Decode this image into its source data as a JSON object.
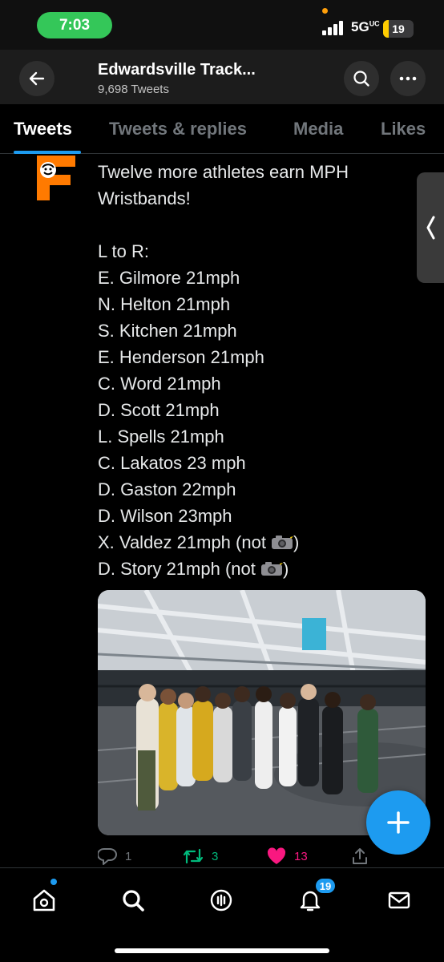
{
  "status_bar": {
    "time": "7:03",
    "network": "5GUC",
    "battery": "19"
  },
  "header": {
    "title": "Edwardsville Track...",
    "subtitle": "9,698 Tweets"
  },
  "tabs": [
    {
      "label": "Tweets",
      "active": true
    },
    {
      "label": "Tweets & replies",
      "active": false
    },
    {
      "label": "Media",
      "active": false
    },
    {
      "label": "Likes",
      "active": false
    }
  ],
  "tweet": {
    "lines": [
      "Twelve more athletes earn MPH",
      "Wristbands!",
      "",
      "L to R:",
      "E. Gilmore 21mph",
      "N. Helton 21mph",
      "S. Kitchen 21mph",
      "E. Henderson 21mph",
      "C. Word 21mph",
      "D. Scott 21mph",
      "L. Spells 21mph",
      "C. Lakatos 23 mph",
      "D. Gaston 22mph",
      "D. Wilson 23mph"
    ],
    "camera_lines": [
      {
        "before": "X. Valdez 21mph (not ",
        "after": ")"
      },
      {
        "before": "D. Story 21mph (not ",
        "after": ")"
      }
    ],
    "reply_count": "1",
    "retweet_count": "3",
    "like_count": "13"
  },
  "bottom_nav": {
    "notifications_badge": "19"
  },
  "colors": {
    "accent": "#1d9bf0",
    "retweet": "#00ba7c",
    "like": "#f91880",
    "status_pill": "#34c759"
  },
  "icons": [
    "back-arrow-icon",
    "search-icon",
    "more-icon",
    "reply-icon",
    "retweet-icon",
    "heart-icon",
    "share-icon",
    "compose-plus-icon",
    "home-icon",
    "explore-search-icon",
    "spaces-icon",
    "bell-icon",
    "mail-icon"
  ]
}
